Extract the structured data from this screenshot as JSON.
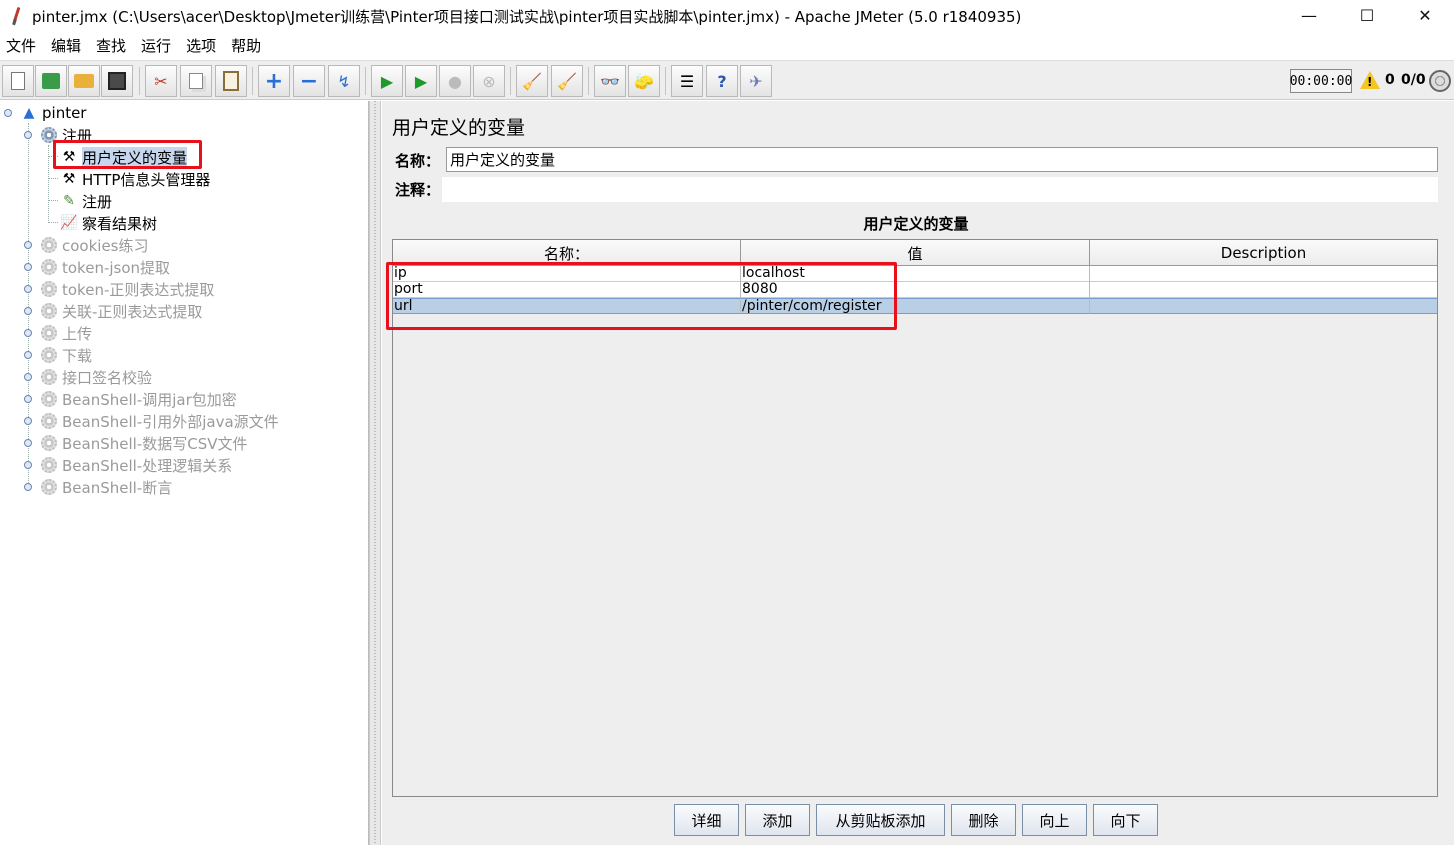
{
  "window": {
    "title": "pinter.jmx (C:\\Users\\acer\\Desktop\\Jmeter训练营\\Pinter项目接口测试实战\\pinter项目实战脚本\\pinter.jmx) - Apache JMeter (5.0 r1840935)",
    "minimize": "—",
    "maximize": "☐",
    "close": "✕"
  },
  "menu": [
    "文件",
    "编辑",
    "查找",
    "运行",
    "选项",
    "帮助"
  ],
  "toolbar": {
    "timer": "00:00:00",
    "warning_count": "0",
    "threads": "0/0"
  },
  "tree": {
    "root": "pinter",
    "group": "注册",
    "children": [
      "用户定义的变量",
      "HTTP信息头管理器",
      "注册",
      "察看结果树"
    ],
    "disabled_groups": [
      "cookies练习",
      "token-json提取",
      "token-正则表达式提取",
      "关联-正则表达式提取",
      "上传",
      "下载",
      "接口签名校验",
      "BeanShell-调用jar包加密",
      "BeanShell-引用外部java源文件",
      "BeanShell-数据写CSV文件",
      "BeanShell-处理逻辑关系",
      "BeanShell-断言"
    ]
  },
  "panel": {
    "title": "用户定义的变量",
    "name_label": "名称：",
    "name_value": "用户定义的变量",
    "comment_label": "注释：",
    "comment_value": "",
    "section_title": "用户定义的变量"
  },
  "table": {
    "headers": [
      "名称：",
      "值",
      "Description"
    ],
    "rows": [
      [
        "ip",
        "localhost",
        ""
      ],
      [
        "port",
        "8080",
        ""
      ],
      [
        "url",
        "/pinter/com/register",
        ""
      ]
    ]
  },
  "buttons": [
    "详细",
    "添加",
    "从剪贴板添加",
    "删除",
    "向上",
    "向下"
  ],
  "colors": {
    "highlight_box": "#e8101a",
    "selection": "#b8cfe5",
    "panel_bg": "#eeeeee"
  }
}
